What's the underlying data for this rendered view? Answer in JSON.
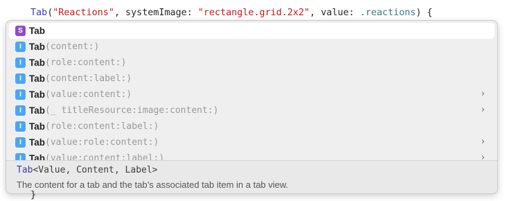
{
  "editor": {
    "line_type": "Tab",
    "line_open": "(",
    "line_str1": "\"Reactions\"",
    "line_mid": ", systemImage: ",
    "line_str2": "\"rectangle.grid.2x2\"",
    "line_value": ", value: ",
    "line_member": ".reactions",
    "line_close": ") {",
    "closing_brace": "}"
  },
  "completions": [
    {
      "badge": "S",
      "kind": "struct",
      "name": "Tab",
      "params": "",
      "chevron": false,
      "selected": true
    },
    {
      "badge": "I",
      "kind": "initializer",
      "name": "Tab",
      "params": "(content:)",
      "chevron": false,
      "selected": false
    },
    {
      "badge": "I",
      "kind": "initializer",
      "name": "Tab",
      "params": "(role:content:)",
      "chevron": false,
      "selected": false
    },
    {
      "badge": "I",
      "kind": "initializer",
      "name": "Tab",
      "params": "(content:label:)",
      "chevron": false,
      "selected": false
    },
    {
      "badge": "I",
      "kind": "initializer",
      "name": "Tab",
      "params": "(value:content:)",
      "chevron": true,
      "selected": false
    },
    {
      "badge": "I",
      "kind": "initializer",
      "name": "Tab",
      "params": "(_ titleResource:image:content:)",
      "chevron": true,
      "selected": false
    },
    {
      "badge": "I",
      "kind": "initializer",
      "name": "Tab",
      "params": "(role:content:label:)",
      "chevron": false,
      "selected": false
    },
    {
      "badge": "I",
      "kind": "initializer",
      "name": "Tab",
      "params": "(value:role:content:)",
      "chevron": true,
      "selected": false
    },
    {
      "badge": "I",
      "kind": "initializer",
      "name": "Tab",
      "params": "(value:content:label:)",
      "chevron": true,
      "selected": false
    }
  ],
  "chevron_glyph": "›",
  "detail": {
    "sig_type": "Tab",
    "sig_generics": "<Value, Content, Label>",
    "description": "The content for a tab and the tab’s associated tab item in a tab view."
  },
  "colors": {
    "struct_badge": "#8e4ec6",
    "init_badge": "#4da6f2",
    "string": "#c41a16",
    "type": "#3b3bb3"
  }
}
